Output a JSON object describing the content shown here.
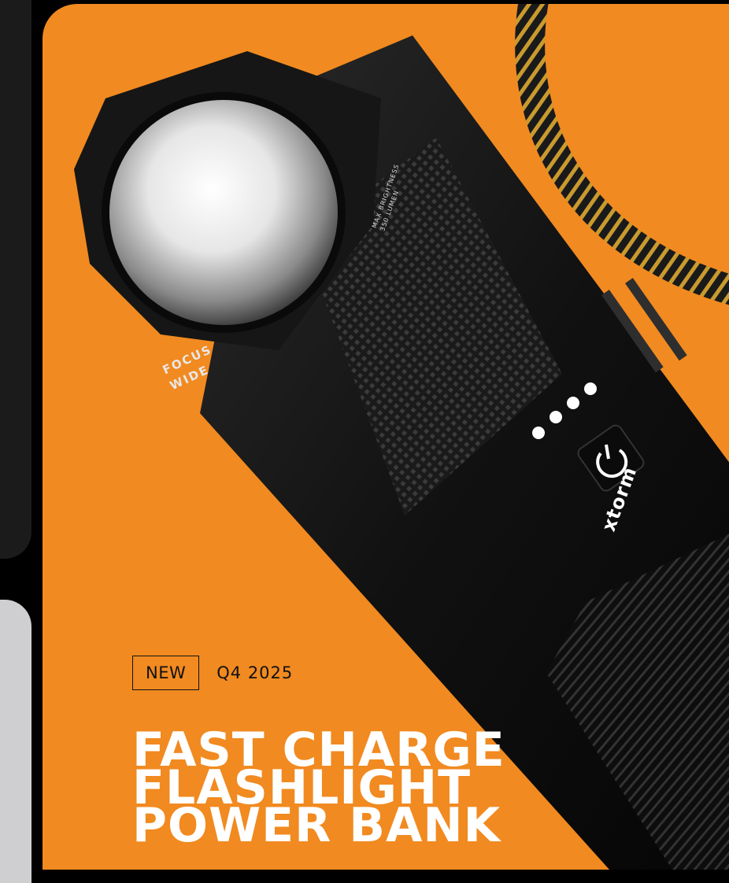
{
  "hero": {
    "brand": "xtorm",
    "lens_labels": {
      "focus": "FOCUS",
      "wide": "WIDE"
    },
    "barrel_labels": {
      "brightness": "MAX BRIGHTNESS",
      "lumen": "350 LUMEN"
    },
    "tag": "NEW",
    "date": "Q4 2025",
    "title_lines": [
      "FAST CHARGE",
      "FLASHLIGHT",
      "POWER BANK"
    ]
  },
  "colors": {
    "accent": "#f18a20",
    "headline": "#ffffff",
    "tag_text": "#111111",
    "side_dark": "#1b1b1b",
    "side_light": "#cfcfd1"
  },
  "icons": [
    "power-icon",
    "battery-indicator-dots"
  ]
}
